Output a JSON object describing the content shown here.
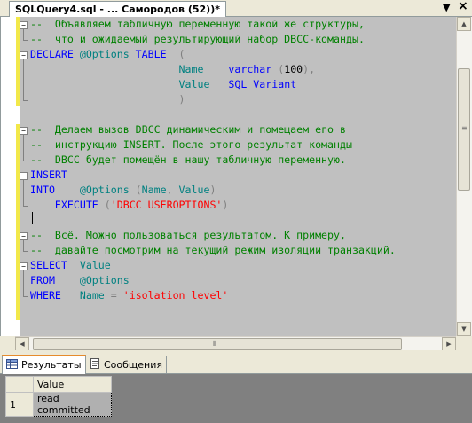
{
  "document_tab": {
    "title": "SQLQuery4.sql - ... Самородов (52))*"
  },
  "tab_controls": {
    "dropdown": "▼",
    "close": "×"
  },
  "editor": {
    "lines": [
      {
        "segments": [
          {
            "t": "--  Объявляем табличную переменную такой же структуры,",
            "c": "cmt"
          }
        ]
      },
      {
        "segments": [
          {
            "t": "--  что и ожидаемый результирующий набор DBCC-команды.",
            "c": "cmt"
          }
        ]
      },
      {
        "segments": [
          {
            "t": "DECLARE ",
            "c": "kw"
          },
          {
            "t": "@Options ",
            "c": "var"
          },
          {
            "t": "TABLE",
            "c": "kw"
          },
          {
            "t": "  (",
            "c": "gr"
          }
        ]
      },
      {
        "segments": [
          {
            "t": "                        ",
            "c": ""
          },
          {
            "t": "Name",
            "c": "var"
          },
          {
            "t": "    ",
            "c": ""
          },
          {
            "t": "varchar",
            "c": "kw"
          },
          {
            "t": " (",
            "c": "gr"
          },
          {
            "t": "100",
            "c": ""
          },
          {
            "t": "),",
            "c": "gr"
          }
        ]
      },
      {
        "segments": [
          {
            "t": "                        ",
            "c": ""
          },
          {
            "t": "Value",
            "c": "var"
          },
          {
            "t": "   ",
            "c": ""
          },
          {
            "t": "SQL_Variant",
            "c": "kw"
          }
        ]
      },
      {
        "segments": [
          {
            "t": "                        ",
            "c": ""
          },
          {
            "t": ")",
            "c": "gr"
          }
        ]
      },
      {
        "segments": []
      },
      {
        "segments": [
          {
            "t": "--  Делаем вызов DBCC динамическим и помещаем его в",
            "c": "cmt"
          }
        ]
      },
      {
        "segments": [
          {
            "t": "--  инструкцию INSERT. После этого результат команды",
            "c": "cmt"
          }
        ]
      },
      {
        "segments": [
          {
            "t": "--  DBCC будет помещён в нашу табличную переменную.",
            "c": "cmt"
          }
        ]
      },
      {
        "segments": [
          {
            "t": "INSERT",
            "c": "kw"
          }
        ]
      },
      {
        "segments": [
          {
            "t": "INTO",
            "c": "kw"
          },
          {
            "t": "    ",
            "c": ""
          },
          {
            "t": "@Options ",
            "c": "var"
          },
          {
            "t": "(",
            "c": "gr"
          },
          {
            "t": "Name",
            "c": "var"
          },
          {
            "t": ", ",
            "c": "gr"
          },
          {
            "t": "Value",
            "c": "var"
          },
          {
            "t": ")",
            "c": "gr"
          }
        ]
      },
      {
        "segments": [
          {
            "t": "    ",
            "c": ""
          },
          {
            "t": "EXECUTE",
            "c": "kw"
          },
          {
            "t": " (",
            "c": "gr"
          },
          {
            "t": "'DBCC USEROPTIONS'",
            "c": "str"
          },
          {
            "t": ")",
            "c": "gr"
          }
        ]
      },
      {
        "segments": []
      },
      {
        "segments": [
          {
            "t": "--  Всё. Можно пользоваться результатом. К примеру,",
            "c": "cmt"
          }
        ]
      },
      {
        "segments": [
          {
            "t": "--  давайте посмотрим на текущий режим изоляции транзакций.",
            "c": "cmt"
          }
        ]
      },
      {
        "segments": [
          {
            "t": "SELECT",
            "c": "kw"
          },
          {
            "t": "  ",
            "c": ""
          },
          {
            "t": "Value",
            "c": "var"
          }
        ]
      },
      {
        "segments": [
          {
            "t": "FROM",
            "c": "kw"
          },
          {
            "t": "    ",
            "c": ""
          },
          {
            "t": "@Options",
            "c": "var"
          }
        ]
      },
      {
        "segments": [
          {
            "t": "WHERE",
            "c": "kw"
          },
          {
            "t": "   ",
            "c": ""
          },
          {
            "t": "Name",
            "c": "var"
          },
          {
            "t": " = ",
            "c": "gr"
          },
          {
            "t": "'isolation level'",
            "c": "str"
          }
        ]
      }
    ]
  },
  "results_tabs": [
    {
      "label": "Результаты",
      "active": true
    },
    {
      "label": "Сообщения",
      "active": false
    }
  ],
  "results_grid": {
    "columns": [
      "Value"
    ],
    "rows": [
      {
        "row_number": "1",
        "cells": [
          "read committed"
        ]
      }
    ]
  },
  "colors": {
    "comment": "#008000",
    "keyword": "#0000ff",
    "string": "#ff0000",
    "variable": "#008080",
    "changed_bar": "#f2e84a",
    "active_tab_accent": "#e68b2c"
  }
}
